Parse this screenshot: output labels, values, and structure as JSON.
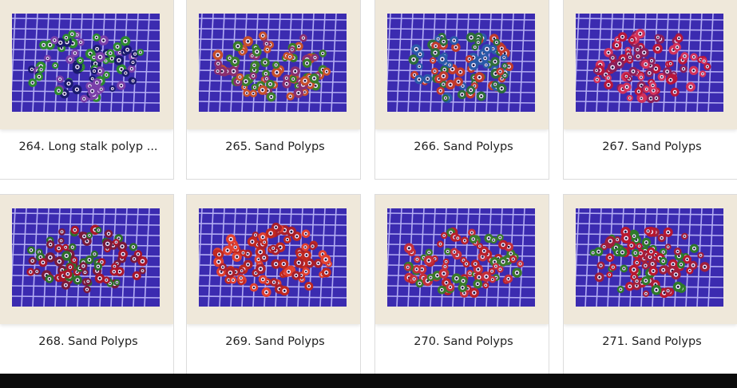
{
  "colors": {
    "card_frame": "#efe8da",
    "caption_text": "#222222",
    "bottom_bar": "#0b0b0b"
  },
  "items": [
    {
      "label": "264. Long stalk polyp ...",
      "palette": [
        "#2d8a2f",
        "#7a3fa8",
        "#1a1a6e"
      ]
    },
    {
      "label": "265. Sand Polyps",
      "palette": [
        "#c7502a",
        "#3a7d2a",
        "#8a2f6e"
      ]
    },
    {
      "label": "266. Sand Polyps",
      "palette": [
        "#2a5aa8",
        "#c0392b",
        "#2d6e3a"
      ]
    },
    {
      "label": "267. Sand Polyps",
      "palette": [
        "#b8163a",
        "#8a1f5a",
        "#d3325a"
      ]
    },
    {
      "label": "268. Sand Polyps",
      "palette": [
        "#a8162a",
        "#2d6e2a",
        "#7a1a3a"
      ]
    },
    {
      "label": "269. Sand Polyps",
      "palette": [
        "#c0281f",
        "#a81f2a",
        "#e0402f"
      ]
    },
    {
      "label": "270. Sand Polyps",
      "palette": [
        "#b8202a",
        "#3a7a2a",
        "#c42f3a"
      ]
    },
    {
      "label": "271. Sand Polyps",
      "palette": [
        "#b8182f",
        "#2e7a2a",
        "#a01f3a"
      ]
    }
  ]
}
